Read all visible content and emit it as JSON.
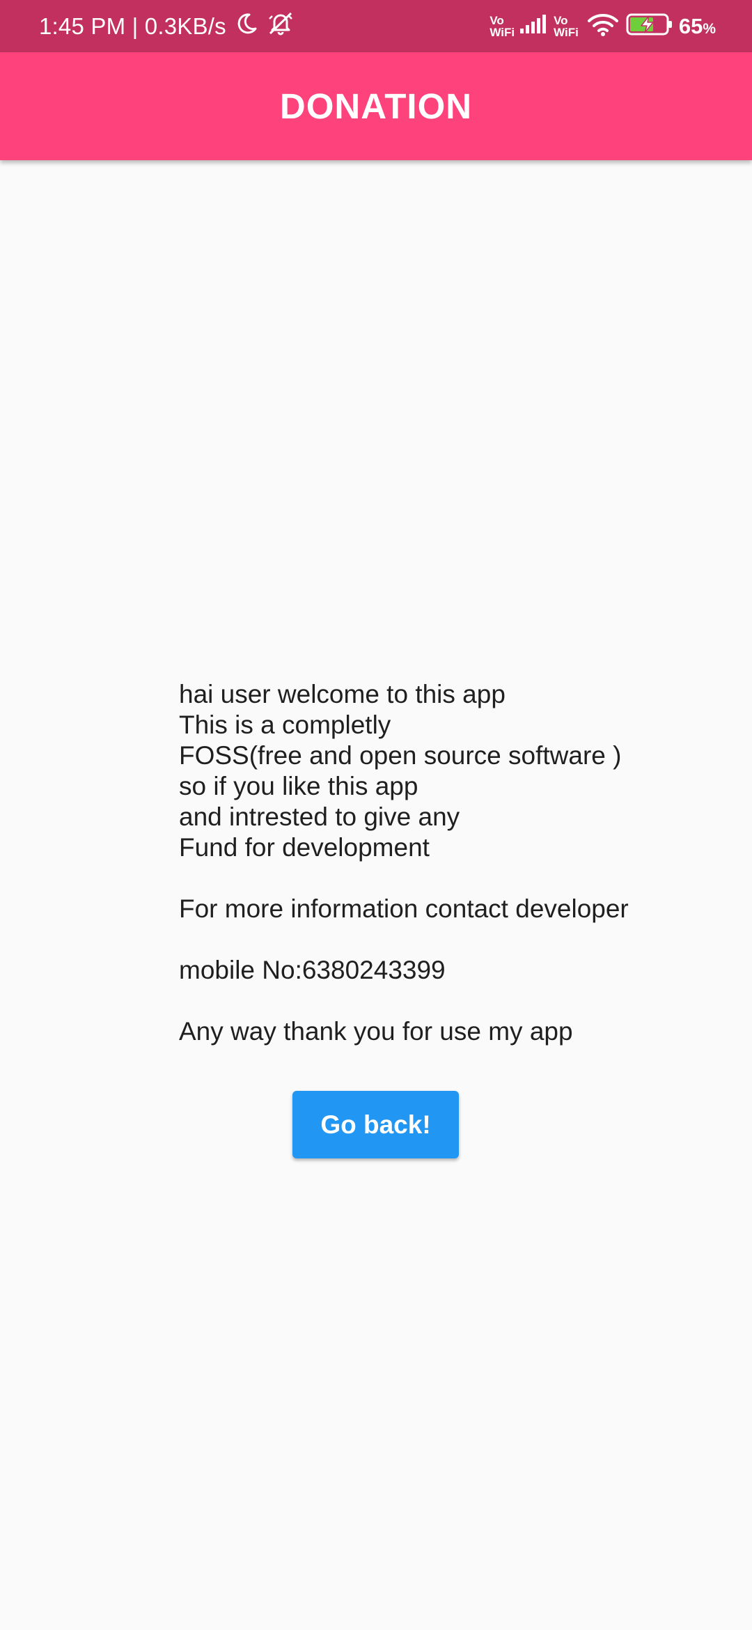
{
  "status_bar": {
    "time_speed": "1:45 PM | 0.3KB/s",
    "vowifi_1_top": "Vo",
    "vowifi_1_bottom": "WiFi",
    "vowifi_2_top": "Vo",
    "vowifi_2_bottom": "WiFi",
    "battery_number": "65",
    "battery_unit": "%",
    "icons": {
      "moon": "moon-icon",
      "bell_off": "bell-off-icon",
      "signal": "signal-icon",
      "wifi": "wifi-icon",
      "battery": "battery-charging-icon"
    }
  },
  "app_bar": {
    "title": "DONATION"
  },
  "message": {
    "lines": [
      "hai user welcome to this app",
      "This is a completly",
      "FOSS(free and open source software )",
      "so if you like this app",
      "and intrested to give any",
      "Fund for development",
      "",
      "For more information contact developer",
      "",
      "mobile No:6380243399",
      "",
      "Any way thank you for use my app"
    ]
  },
  "button": {
    "label": "Go back!"
  },
  "colors": {
    "status_bar": "#c2305f",
    "app_bar": "#fe427c",
    "background": "#fafafa",
    "button": "#2196f3",
    "battery_fill": "#6fcf3a"
  }
}
